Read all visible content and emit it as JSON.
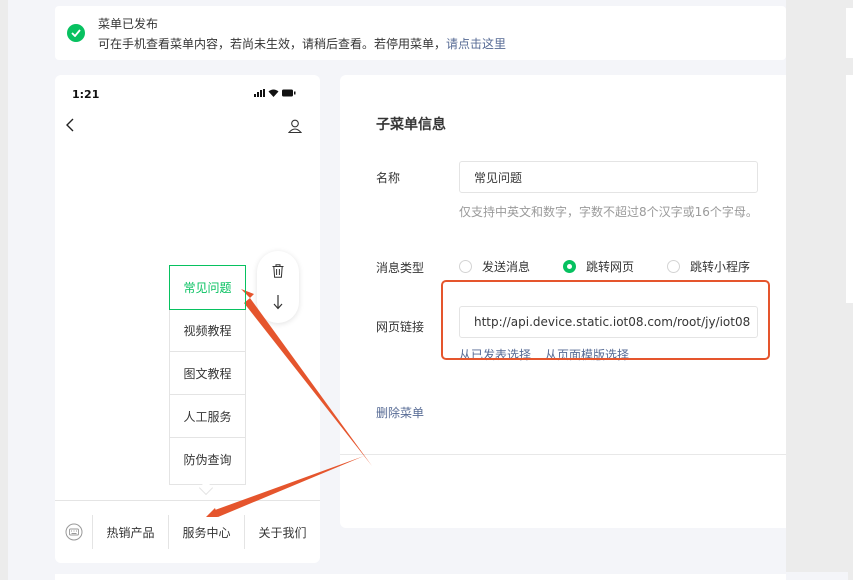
{
  "notice": {
    "title": "菜单已发布",
    "message": "可在手机查看菜单内容，若尚未生效，请稍后查看。若停用菜单，",
    "link": "请点击这里"
  },
  "phone": {
    "time": "1:21",
    "submenu": [
      "常见问题",
      "视频教程",
      "图文教程",
      "人工服务",
      "防伪查询"
    ],
    "tabs": [
      "热销产品",
      "服务中心",
      "关于我们"
    ]
  },
  "editor": {
    "heading": "子菜单信息",
    "name_label": "名称",
    "name_value": "常见问题",
    "name_hint": "仅支持中英文和数字，字数不超过8个汉字或16个字母。",
    "type_label": "消息类型",
    "type_options": [
      "发送消息",
      "跳转网页",
      "跳转小程序"
    ],
    "type_selected": "跳转网页",
    "url_label": "网页链接",
    "url_value": "http://api.device.static.iot08.com/root/jy/iot08",
    "url_sources": [
      "从已发表选择",
      "从页面模版选择"
    ],
    "delete_label": "删除菜单"
  },
  "colors": {
    "accent": "#07c160",
    "link": "#576b95",
    "annotation": "#e5552d"
  },
  "icons": [
    "success-check-icon",
    "back-arrow-icon",
    "user-profile-icon",
    "trash-icon",
    "move-down-arrow-icon",
    "keyboard-icon",
    "signal-icon",
    "wifi-icon",
    "battery-icon"
  ]
}
